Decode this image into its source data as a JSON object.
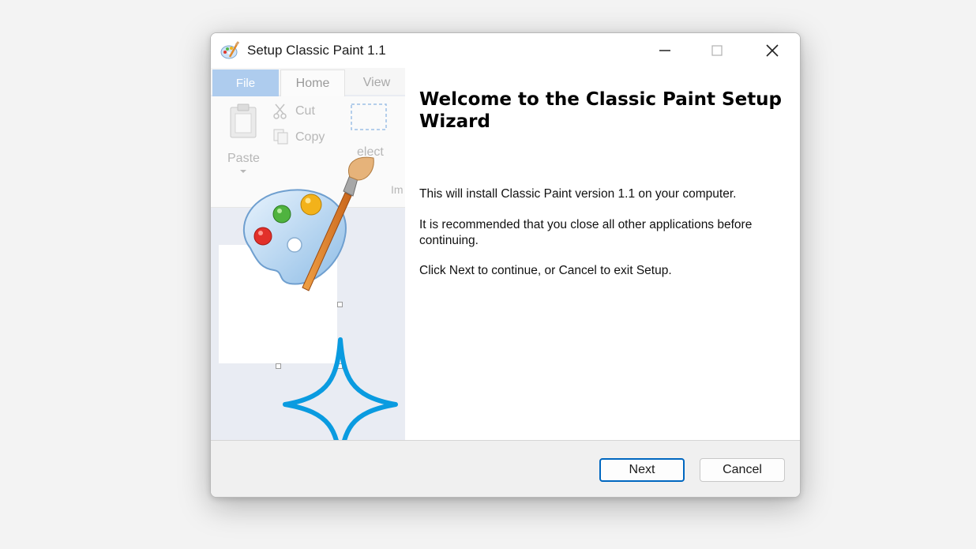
{
  "window": {
    "title": "Setup Classic Paint 1.1"
  },
  "side_panel": {
    "tabs": [
      "File",
      "Home",
      "View"
    ],
    "ribbon_labels": {
      "cut": "Cut",
      "copy": "Copy",
      "paste": "Paste",
      "select": "elect",
      "image_fragment": "Im"
    }
  },
  "content": {
    "title": "Welcome to the Classic Paint Setup Wizard",
    "paragraphs": [
      "This will install Classic Paint version 1.1 on your computer.",
      "It is recommended that you close all other applications before continuing.",
      "Click Next to continue, or Cancel to exit Setup."
    ]
  },
  "footer": {
    "next_label": "Next",
    "cancel_label": "Cancel"
  },
  "colors": {
    "accent": "#0067c0",
    "file_tab": "#aeccee",
    "sparkle": "#0a9be0"
  },
  "icons": [
    "paint-palette-icon",
    "minimize-icon",
    "maximize-icon",
    "close-icon",
    "scissors-icon",
    "copy-icon",
    "clipboard-icon",
    "sparkle-icon"
  ]
}
